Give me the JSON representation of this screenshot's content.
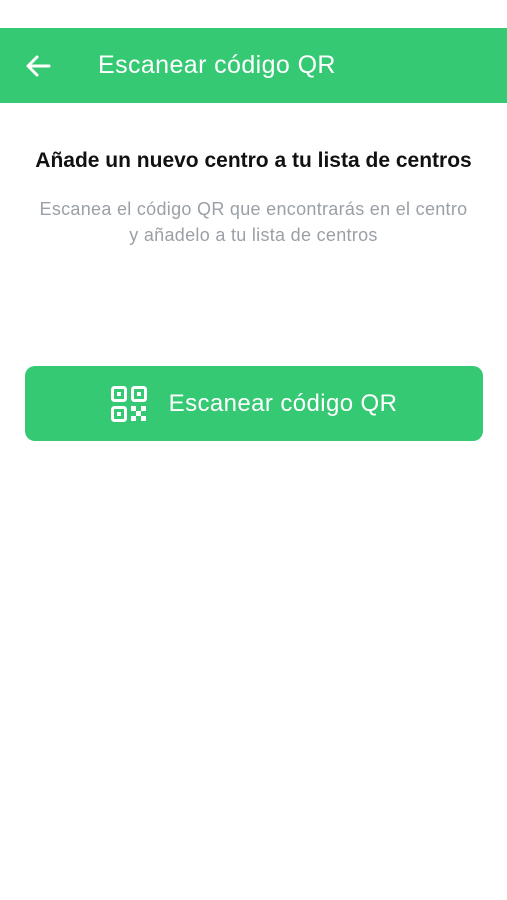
{
  "app_bar": {
    "title": "Escanear código QR",
    "back_icon": "arrow-left-icon",
    "color": "#35c973"
  },
  "main": {
    "heading": "Añade un nuevo centro a tu lista de centros",
    "description": "Escanea el código QR que encontrarás en el centro y añadelo a tu lista de centros"
  },
  "scan_button": {
    "label": "Escanear código QR",
    "icon": "qr-code-icon",
    "color": "#35c973"
  }
}
